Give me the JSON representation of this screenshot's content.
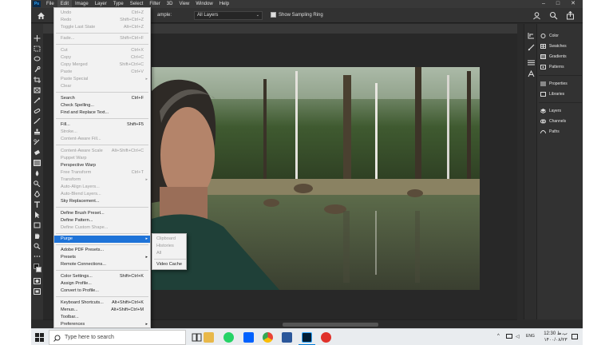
{
  "app": {
    "logo_text": "Ps"
  },
  "menubar": {
    "items": [
      "File",
      "Edit",
      "Image",
      "Layer",
      "Type",
      "Select",
      "Filter",
      "3D",
      "View",
      "Window",
      "Help"
    ]
  },
  "options": {
    "sample_label": "ample:",
    "sample_value": "All Layers",
    "ring_label": "Show Sampling Ring"
  },
  "edit_menu": {
    "undo": {
      "label": "Undo",
      "shortcut": "Ctrl+Z"
    },
    "redo": {
      "label": "Redo",
      "shortcut": "Shift+Ctrl+Z"
    },
    "toggle_last": {
      "label": "Toggle Last State",
      "shortcut": "Alt+Ctrl+Z"
    },
    "fade": {
      "label": "Fade...",
      "shortcut": "Shift+Ctrl+F"
    },
    "cut": {
      "label": "Cut",
      "shortcut": "Ctrl+X"
    },
    "copy": {
      "label": "Copy",
      "shortcut": "Ctrl+C"
    },
    "copy_merged": {
      "label": "Copy Merged",
      "shortcut": "Shift+Ctrl+C"
    },
    "paste": {
      "label": "Paste",
      "shortcut": "Ctrl+V"
    },
    "paste_special": {
      "label": "Paste Special"
    },
    "clear": {
      "label": "Clear"
    },
    "search": {
      "label": "Search",
      "shortcut": "Ctrl+F"
    },
    "check_spelling": {
      "label": "Check Spelling..."
    },
    "find_replace": {
      "label": "Find and Replace Text..."
    },
    "fill": {
      "label": "Fill...",
      "shortcut": "Shift+F5"
    },
    "stroke": {
      "label": "Stroke..."
    },
    "content_aware_fill": {
      "label": "Content-Aware Fill..."
    },
    "content_aware_scale": {
      "label": "Content-Aware Scale",
      "shortcut": "Alt+Shift+Ctrl+C"
    },
    "puppet_warp": {
      "label": "Puppet Warp"
    },
    "perspective_warp": {
      "label": "Perspective Warp"
    },
    "free_transform": {
      "label": "Free Transform",
      "shortcut": "Ctrl+T"
    },
    "transform": {
      "label": "Transform"
    },
    "auto_align": {
      "label": "Auto-Align Layers..."
    },
    "auto_blend": {
      "label": "Auto-Blend Layers..."
    },
    "sky_replacement": {
      "label": "Sky Replacement..."
    },
    "define_brush": {
      "label": "Define Brush Preset..."
    },
    "define_pattern": {
      "label": "Define Pattern..."
    },
    "define_shape": {
      "label": "Define Custom Shape..."
    },
    "purge": {
      "label": "Purge"
    },
    "pdf_presets": {
      "label": "Adobe PDF Presets..."
    },
    "presets": {
      "label": "Presets"
    },
    "remote": {
      "label": "Remote Connections..."
    },
    "color_settings": {
      "label": "Color Settings...",
      "shortcut": "Shift+Ctrl+K"
    },
    "assign_profile": {
      "label": "Assign Profile..."
    },
    "convert_profile": {
      "label": "Convert to Profile..."
    },
    "keyboard_shortcuts": {
      "label": "Keyboard Shortcuts...",
      "shortcut": "Alt+Shift+Ctrl+K"
    },
    "menus": {
      "label": "Menus...",
      "shortcut": "Alt+Shift+Ctrl+M"
    },
    "toolbar": {
      "label": "Toolbar..."
    },
    "preferences": {
      "label": "Preferences"
    }
  },
  "purge_submenu": {
    "items": [
      "Clipboard",
      "Histories",
      "All",
      "Video Cache"
    ]
  },
  "panels": {
    "items": [
      "Color",
      "Swatches",
      "Gradients",
      "Patterns",
      "Properties",
      "Libraries",
      "Layers",
      "Channels",
      "Paths"
    ]
  },
  "taskbar": {
    "search_placeholder": "Type here to search",
    "time": "12:30 ب.ظ",
    "date": "۱۴۰۰/۰۸/۲۳"
  },
  "colors": {
    "highlight": "#1e73d8",
    "menu_bg": "#f2f2f2",
    "app_bg": "#2b2b2b"
  }
}
